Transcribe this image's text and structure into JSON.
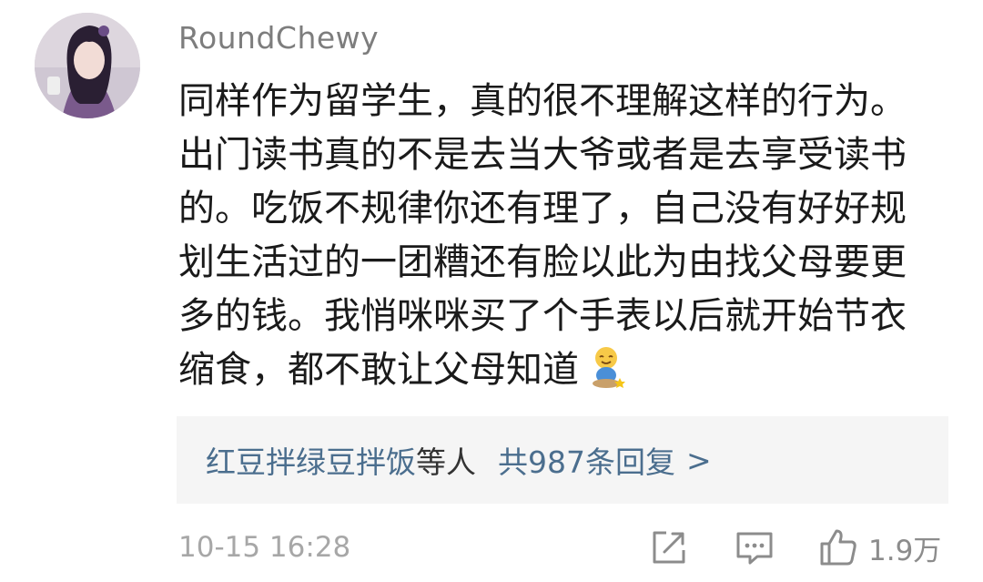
{
  "comment": {
    "username": "RoundChewy",
    "lines": [
      "同样作为留学生，真的很不理解这样的行为。",
      "出门读书真的不是去当大爷或者是去享受读书",
      "的。吃饭不规律你还有理了，自己没有好好规",
      "划生活过的一团糟还有脸以此为由找父母要更",
      "多的钱。我悄咪咪买了个手表以后就开始节衣",
      "缩食，都不敢让父母知道"
    ],
    "emoji": "smiling-sitting-person-emoji"
  },
  "replies": {
    "names": "红豆拌绿豆拌饭",
    "names_suffix": "等人",
    "count_text": "共987条回复",
    "chevron": ">"
  },
  "footer": {
    "timestamp": "10-15 16:28",
    "likes": "1.9万"
  },
  "icons": {
    "share": "share-icon",
    "comment": "comment-icon",
    "like": "thumbs-up-icon"
  },
  "colors": {
    "link": "#4b6e8e",
    "meta": "#a7a7a7",
    "reply_bg": "#f5f5f5"
  }
}
